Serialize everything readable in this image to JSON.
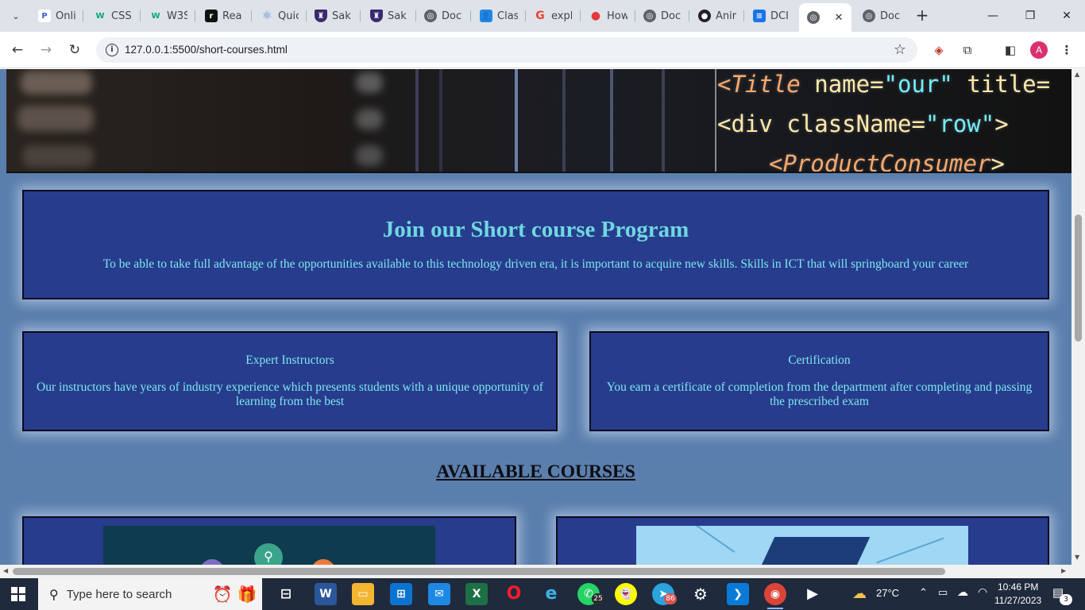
{
  "browser": {
    "tabs": [
      {
        "title": "Onli",
        "icon": "p-logo-icon",
        "color": "#3b5bdb"
      },
      {
        "title": "CSS",
        "icon": "w3schools-icon",
        "color": "#04aa6d"
      },
      {
        "title": "W3S",
        "icon": "w3schools-icon",
        "color": "#04aa6d"
      },
      {
        "title": "Rea",
        "icon": "r-logo-icon",
        "color": "#111111"
      },
      {
        "title": "Quic",
        "icon": "react-atom-icon",
        "color": "#4a7bd0"
      },
      {
        "title": "Sak",
        "icon": "shield-crest-icon",
        "color": "#3a2a6e"
      },
      {
        "title": "Sak",
        "icon": "shield-crest-icon",
        "color": "#3a2a6e"
      },
      {
        "title": "Doc",
        "icon": "globe-icon",
        "color": "#5f6368"
      },
      {
        "title": "Clas",
        "icon": "classroom-icon",
        "color": "#1e88e5"
      },
      {
        "title": "expl",
        "icon": "google-g-icon",
        "color": "#ea4335"
      },
      {
        "title": "How",
        "icon": "map-pin-icon",
        "color": "#e53935"
      },
      {
        "title": "Doc",
        "icon": "globe-icon",
        "color": "#5f6368"
      },
      {
        "title": "Anir",
        "icon": "github-icon",
        "color": "#222222"
      },
      {
        "title": "DCI",
        "icon": "docs-icon",
        "color": "#1a73e8"
      }
    ],
    "active_tab_close": "✕",
    "last_tab": {
      "title": "Doc",
      "icon": "globe-icon"
    },
    "new_tab_label": "+",
    "address": "127.0.0.1:5500/short-courses.html",
    "profile_initial": "A",
    "window": {
      "minimize": "—",
      "maximize": "❐",
      "close": "✕"
    }
  },
  "hero": {
    "code_lines": [
      {
        "p1": "<",
        "tag": "Title",
        "attr": " name=",
        "val": "\"our\"",
        "rest": " title="
      },
      {
        "p1": "<",
        "tag": "div",
        "attr": " className=",
        "val": "\"row\"",
        "rest": ">"
      },
      {
        "p1": "<",
        "tag": "ProductConsumer",
        "attr": "",
        "val": "",
        "rest": ">"
      }
    ]
  },
  "join": {
    "title": "Join our Short course Program",
    "text": "To be able to take full advantage of the opportunities available to this technology driven era, it is important to acquire new skills. Skills in ICT that will springboard your career"
  },
  "features": [
    {
      "title": "Expert Instructors",
      "text": "Our instructors have years of industry experience which presents students with a unique opportunity of learning from the best"
    },
    {
      "title": "Certification",
      "text": "You earn a certificate of completion from the department after completing and passing the prescribed exam"
    }
  ],
  "courses_heading": "AVAILABLE COURSES",
  "taskbar": {
    "search_placeholder": "Type here to search",
    "whatsapp_badge": "25",
    "telegram_badge": "86",
    "temperature": "27°C",
    "time": "10:46 PM",
    "date": "11/27/2023",
    "notification_count": "3"
  },
  "colors": {
    "page_bg": "#5b7fad",
    "card_bg": "#273c8c",
    "card_text": "#7de7ef",
    "heading_text": "#0d0d12"
  }
}
